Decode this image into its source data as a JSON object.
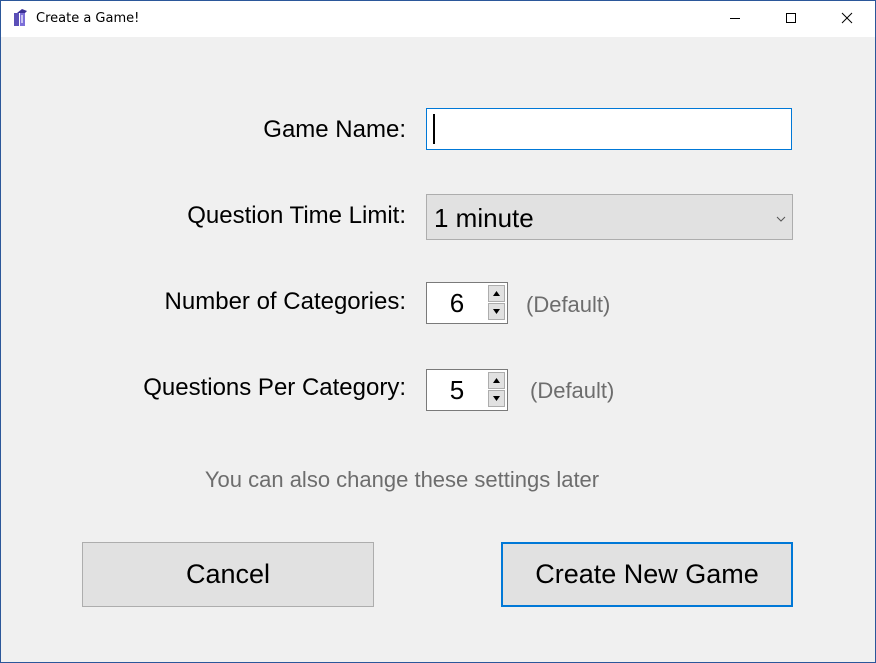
{
  "window": {
    "title": "Create a Game!",
    "accent_color": "#0078d7",
    "icon": "app-icon"
  },
  "form": {
    "game_name": {
      "label": "Game Name:",
      "value": ""
    },
    "time_limit": {
      "label": "Question Time Limit:",
      "selected": "1 minute"
    },
    "categories": {
      "label": "Number of Categories:",
      "value": "6",
      "hint": "(Default)"
    },
    "questions_per_category": {
      "label": "Questions Per Category:",
      "value": "5",
      "hint": "(Default)"
    },
    "note": "You can also change these settings later"
  },
  "buttons": {
    "cancel": "Cancel",
    "create": "Create New Game"
  }
}
